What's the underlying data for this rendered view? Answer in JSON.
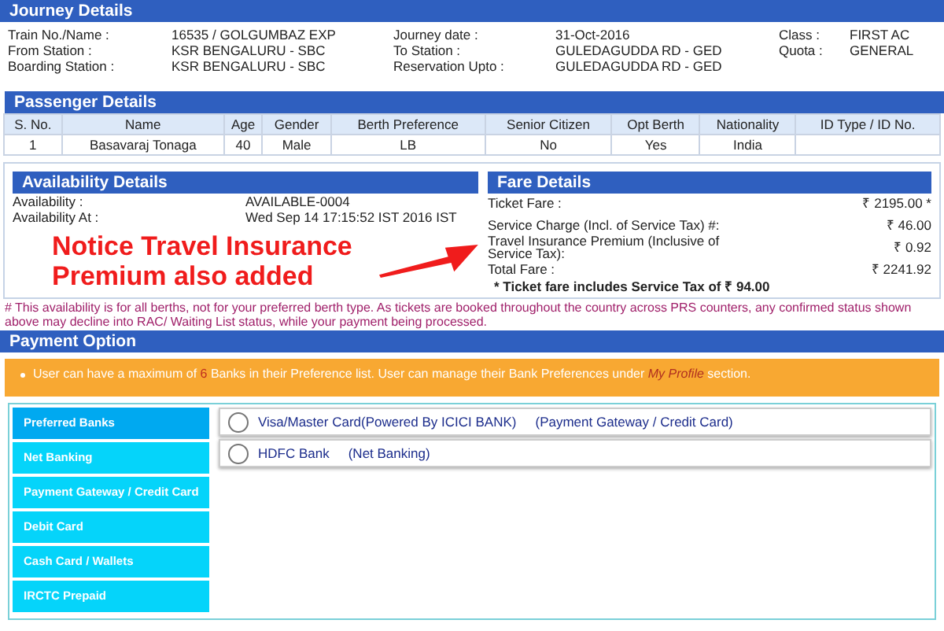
{
  "journey": {
    "title": "Journey Details",
    "fields": [
      {
        "label": "Train No./Name :",
        "value": "16535 / GOLGUMBAZ EXP"
      },
      {
        "label": "Journey date :",
        "value": "31-Oct-2016"
      },
      {
        "label": "Class :",
        "value": "FIRST AC"
      },
      {
        "label": "From Station :",
        "value": "KSR BENGALURU - SBC"
      },
      {
        "label": "To Station :",
        "value": "GULEDAGUDDA RD - GED"
      },
      {
        "label": "Quota :",
        "value": "GENERAL"
      },
      {
        "label": "Boarding Station :",
        "value": "KSR BENGALURU - SBC"
      },
      {
        "label": "Reservation Upto :",
        "value": "GULEDAGUDDA RD - GED"
      }
    ]
  },
  "passengers": {
    "title": "Passenger Details",
    "columns": [
      "S. No.",
      "Name",
      "Age",
      "Gender",
      "Berth Preference",
      "Senior Citizen",
      "Opt Berth",
      "Nationality",
      "ID Type / ID No."
    ],
    "rows": [
      [
        "1",
        "Basavaraj Tonaga",
        "40",
        "Male",
        "LB",
        "No",
        "Yes",
        "India",
        null
      ]
    ]
  },
  "availability": {
    "title": "Availability Details",
    "fields": [
      {
        "label": "Availability :",
        "value": "AVAILABLE-0004"
      },
      {
        "label": "Availability At :",
        "value": "Wed Sep 14 17:15:52 IST 2016 IST"
      }
    ]
  },
  "annotation": {
    "text": "Notice Travel Insurance Premium also added"
  },
  "fare": {
    "title": "Fare Details",
    "fields": [
      {
        "label": "Ticket Fare :",
        "value": "₹ 2195.00 *"
      },
      {
        "label": "Service Charge (Incl. of Service Tax) #:",
        "value": "₹ 46.00"
      },
      {
        "label": "Travel Insurance Premium (Inclusive of Service Tax):",
        "value": "₹ 0.92"
      },
      {
        "label": "Total Fare :",
        "value": "₹ 2241.92"
      }
    ],
    "note": "* Ticket fare includes Service Tax of ₹ 94.00"
  },
  "disclaimer": "# This availability is for all berths, not for your preferred berth type. As tickets are booked throughout the country across PRS counters, any confirmed status shown above may decline into RAC/ Waiting List status, while your payment being processed.",
  "payment": {
    "title": "Payment Option",
    "notice": {
      "before": "User can have a maximum of",
      "count": "6",
      "middle": "Banks in their Preference list. User can manage their Bank Preferences under",
      "link": "My Profile",
      "after": "section."
    },
    "tabs": [
      {
        "label": "Preferred Banks",
        "selected": true
      },
      {
        "label": "Net Banking",
        "selected": false
      },
      {
        "label": "Payment Gateway / Credit Card",
        "selected": false
      },
      {
        "label": "Debit Card",
        "selected": false
      },
      {
        "label": "Cash Card / Wallets",
        "selected": false
      },
      {
        "label": "IRCTC Prepaid",
        "selected": false
      }
    ],
    "options": [
      {
        "name": "Visa/Master Card(Powered By ICICI BANK)",
        "type": "(Payment Gateway / Credit Card)",
        "checked": false
      },
      {
        "name": "HDFC Bank",
        "type": "(Net Banking)",
        "checked": false
      }
    ]
  }
}
